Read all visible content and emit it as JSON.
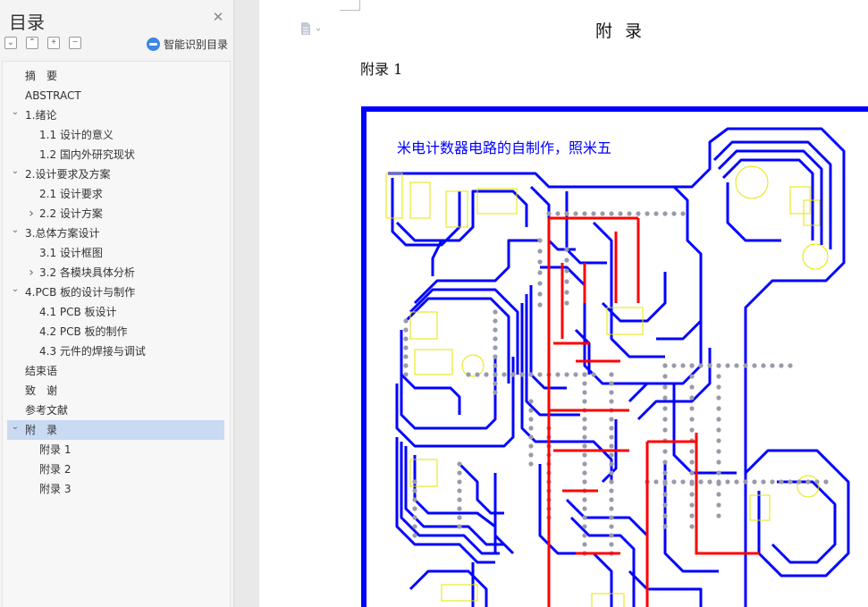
{
  "sidebar": {
    "title": "目录",
    "smart_label": "智能识别目录",
    "tool_icons": [
      "collapse-all-icon",
      "expand-all-icon",
      "add-heading-icon",
      "remove-heading-icon"
    ],
    "toc": [
      {
        "label": "摘　要",
        "level": 1,
        "caret": ""
      },
      {
        "label": "ABSTRACT",
        "level": 1,
        "caret": ""
      },
      {
        "label": "1.绪论",
        "level": 1,
        "caret": "down"
      },
      {
        "label": "1.1 设计的意义",
        "level": 2,
        "caret": ""
      },
      {
        "label": "1.2 国内外研究现状",
        "level": 2,
        "caret": ""
      },
      {
        "label": "2.设计要求及方案",
        "level": 1,
        "caret": "down"
      },
      {
        "label": "2.1 设计要求",
        "level": 2,
        "caret": ""
      },
      {
        "label": "2.2 设计方案",
        "level": 2,
        "caret": "right"
      },
      {
        "label": "3.总体方案设计",
        "level": 1,
        "caret": "down"
      },
      {
        "label": "3.1 设计框图",
        "level": 2,
        "caret": ""
      },
      {
        "label": "3.2 各模块具体分析",
        "level": 2,
        "caret": "right"
      },
      {
        "label": "4.PCB 板的设计与制作",
        "level": 1,
        "caret": "down"
      },
      {
        "label": "4.1 PCB 板设计",
        "level": 2,
        "caret": ""
      },
      {
        "label": "4.2 PCB 板的制作",
        "level": 2,
        "caret": ""
      },
      {
        "label": "4.3 元件的焊接与调试",
        "level": 2,
        "caret": ""
      },
      {
        "label": "结束语",
        "level": 1,
        "caret": ""
      },
      {
        "label": "致　谢",
        "level": 1,
        "caret": ""
      },
      {
        "label": "参考文献",
        "level": 1,
        "caret": ""
      },
      {
        "label": "附　录",
        "level": 1,
        "caret": "down",
        "active": true
      },
      {
        "label": "附录 1",
        "level": 2,
        "caret": ""
      },
      {
        "label": "附录 2",
        "level": 2,
        "caret": ""
      },
      {
        "label": "附录 3",
        "level": 2,
        "caret": ""
      }
    ]
  },
  "document": {
    "heading": "附录",
    "subheading": "附录 1",
    "pcb_text": "米电计数器电路的自制作，照米五",
    "colors": {
      "pcb_blue": "#0000ff",
      "pcb_red": "#ff0000",
      "pcb_yellow": "#e6e600",
      "active_toc": "#c9daf3"
    }
  }
}
